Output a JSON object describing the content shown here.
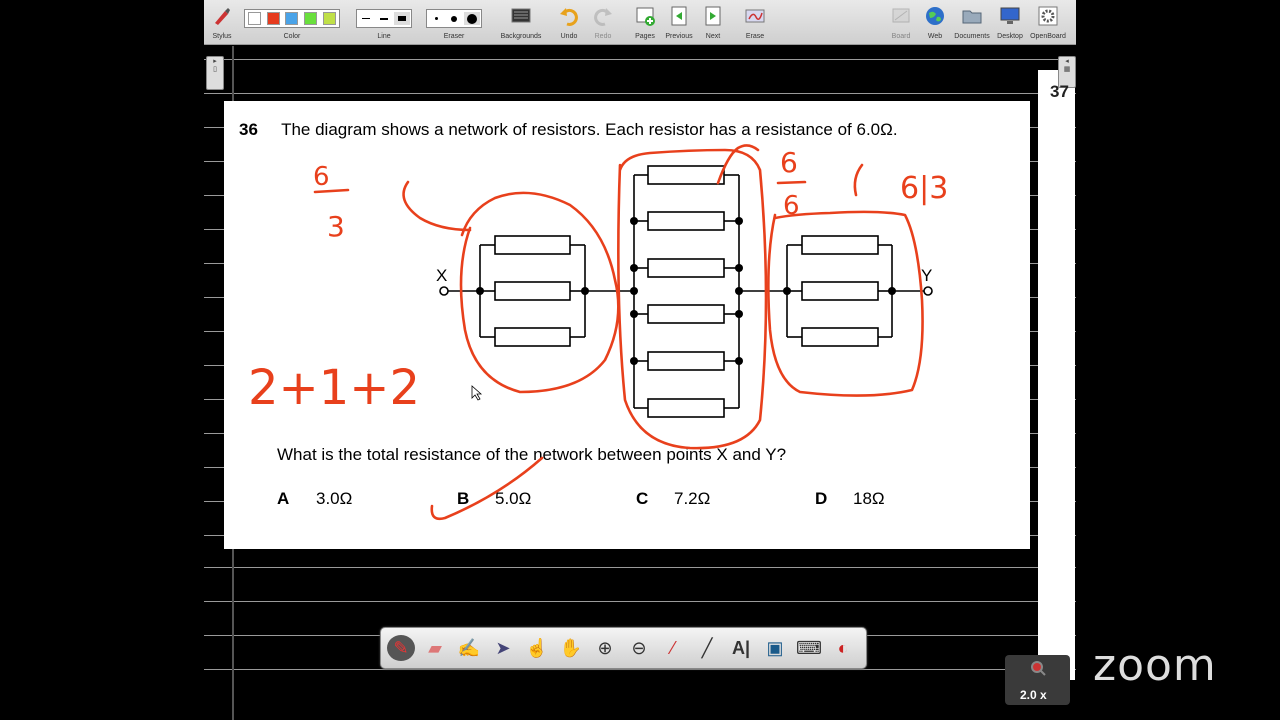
{
  "toolbar": {
    "stylus": "Stylus",
    "color": "Color",
    "line": "Line",
    "eraser": "Eraser",
    "backgrounds": "Backgrounds",
    "undo": "Undo",
    "redo": "Redo",
    "pages": "Pages",
    "previous": "Previous",
    "next": "Next",
    "erase": "Erase",
    "board": "Board",
    "web": "Web",
    "documents": "Documents",
    "desktop": "Desktop",
    "openboard": "OpenBoard",
    "colors": [
      "#ffffff",
      "#e63b1e",
      "#4aa3e8",
      "#6adf3d",
      "#c0e048"
    ]
  },
  "page_number": "37",
  "question": {
    "number": "36",
    "stem": "The diagram shows a network of resistors. Each resistor has a resistance of 6.0Ω.",
    "prompt": "What is the total resistance of the network between points X and Y?",
    "label_x": "X",
    "label_y": "Y",
    "options": [
      {
        "letter": "A",
        "value": "3.0Ω"
      },
      {
        "letter": "B",
        "value": "5.0Ω"
      },
      {
        "letter": "C",
        "value": "7.2Ω"
      },
      {
        "letter": "D",
        "value": "18Ω"
      }
    ]
  },
  "annotations": {
    "ink_color": "#e8401c",
    "left_fraction_num": "6",
    "left_fraction_den": "3",
    "mid_fraction_num": "6",
    "mid_fraction_den": "6",
    "right_note": "6|3",
    "sum_note": "2+1+2"
  },
  "zoom": {
    "magnification": "2.0 x",
    "logo": "zoom"
  }
}
